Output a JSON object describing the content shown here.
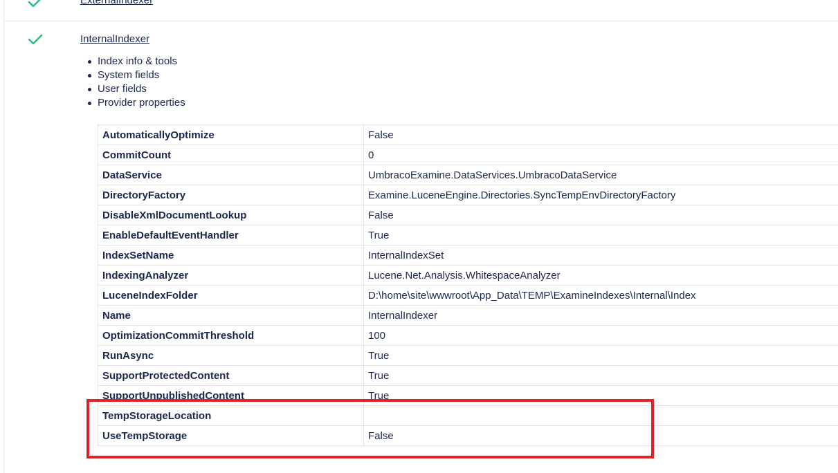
{
  "indexers": {
    "previous": {
      "name": "ExternalIndexer"
    },
    "current": {
      "name": "InternalIndexer"
    }
  },
  "tools": [
    {
      "label": "Index info & tools"
    },
    {
      "label": "System fields"
    },
    {
      "label": "User fields"
    },
    {
      "label": "Provider properties"
    }
  ],
  "properties": [
    {
      "key": "AutomaticallyOptimize",
      "value": "False"
    },
    {
      "key": "CommitCount",
      "value": "0"
    },
    {
      "key": "DataService",
      "value": "UmbracoExamine.DataServices.UmbracoDataService"
    },
    {
      "key": "DirectoryFactory",
      "value": "Examine.LuceneEngine.Directories.SyncTempEnvDirectoryFactory"
    },
    {
      "key": "DisableXmlDocumentLookup",
      "value": "False"
    },
    {
      "key": "EnableDefaultEventHandler",
      "value": "True"
    },
    {
      "key": "IndexSetName",
      "value": "InternalIndexSet"
    },
    {
      "key": "IndexingAnalyzer",
      "value": "Lucene.Net.Analysis.WhitespaceAnalyzer"
    },
    {
      "key": "LuceneIndexFolder",
      "value": "D:\\home\\site\\wwwroot\\App_Data\\TEMP\\ExamineIndexes\\Internal\\Index"
    },
    {
      "key": "Name",
      "value": "InternalIndexer"
    },
    {
      "key": "OptimizationCommitThreshold",
      "value": "100"
    },
    {
      "key": "RunAsync",
      "value": "True"
    },
    {
      "key": "SupportProtectedContent",
      "value": "True"
    },
    {
      "key": "SupportUnpublishedContent",
      "value": "True"
    },
    {
      "key": "TempStorageLocation",
      "value": ""
    },
    {
      "key": "UseTempStorage",
      "value": "False"
    }
  ],
  "colors": {
    "check": "#2bc37c",
    "text": "#1b264f",
    "highlight": "#e02128"
  },
  "icons": {
    "status": "checkmark-icon"
  }
}
